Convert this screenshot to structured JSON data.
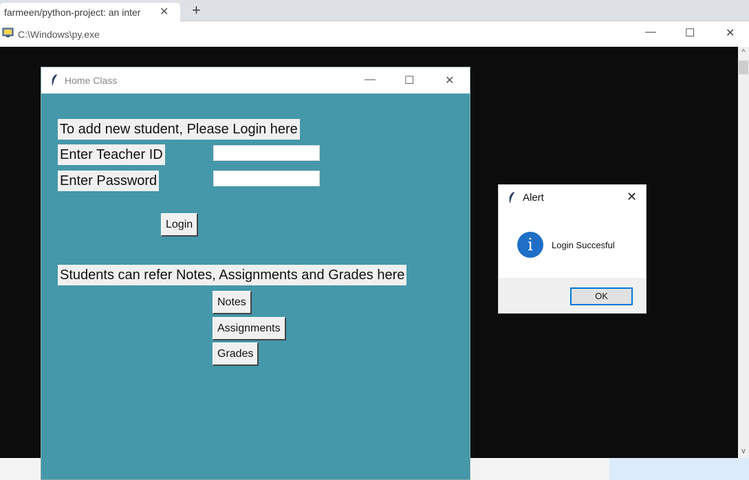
{
  "browser": {
    "tab_title": "farmeen/python-project: an inter",
    "tab_close": "✕",
    "new_tab": "+"
  },
  "console": {
    "title": "C:\\Windows\\py.exe",
    "minimize": "—",
    "maximize": "☐",
    "close": "✕",
    "scroll_up": "^",
    "scroll_down": "v"
  },
  "home_window": {
    "title": "Home Class",
    "minimize": "—",
    "maximize": "☐",
    "close": "✕",
    "login_heading": "To add new student, Please Login here",
    "teacher_id_label": "Enter Teacher ID",
    "teacher_id_value": "",
    "password_label": "Enter Password",
    "password_value": "",
    "login_button": "Login",
    "students_heading": "Students can refer Notes, Assignments and Grades here",
    "notes_button": "Notes",
    "assignments_button": "Assignments",
    "grades_button": "Grades",
    "background_color": "#4598a9"
  },
  "alert": {
    "title": "Alert",
    "close": "✕",
    "icon": "info-icon",
    "icon_glyph": "i",
    "message": "Login Succesful",
    "ok_button": "OK"
  }
}
